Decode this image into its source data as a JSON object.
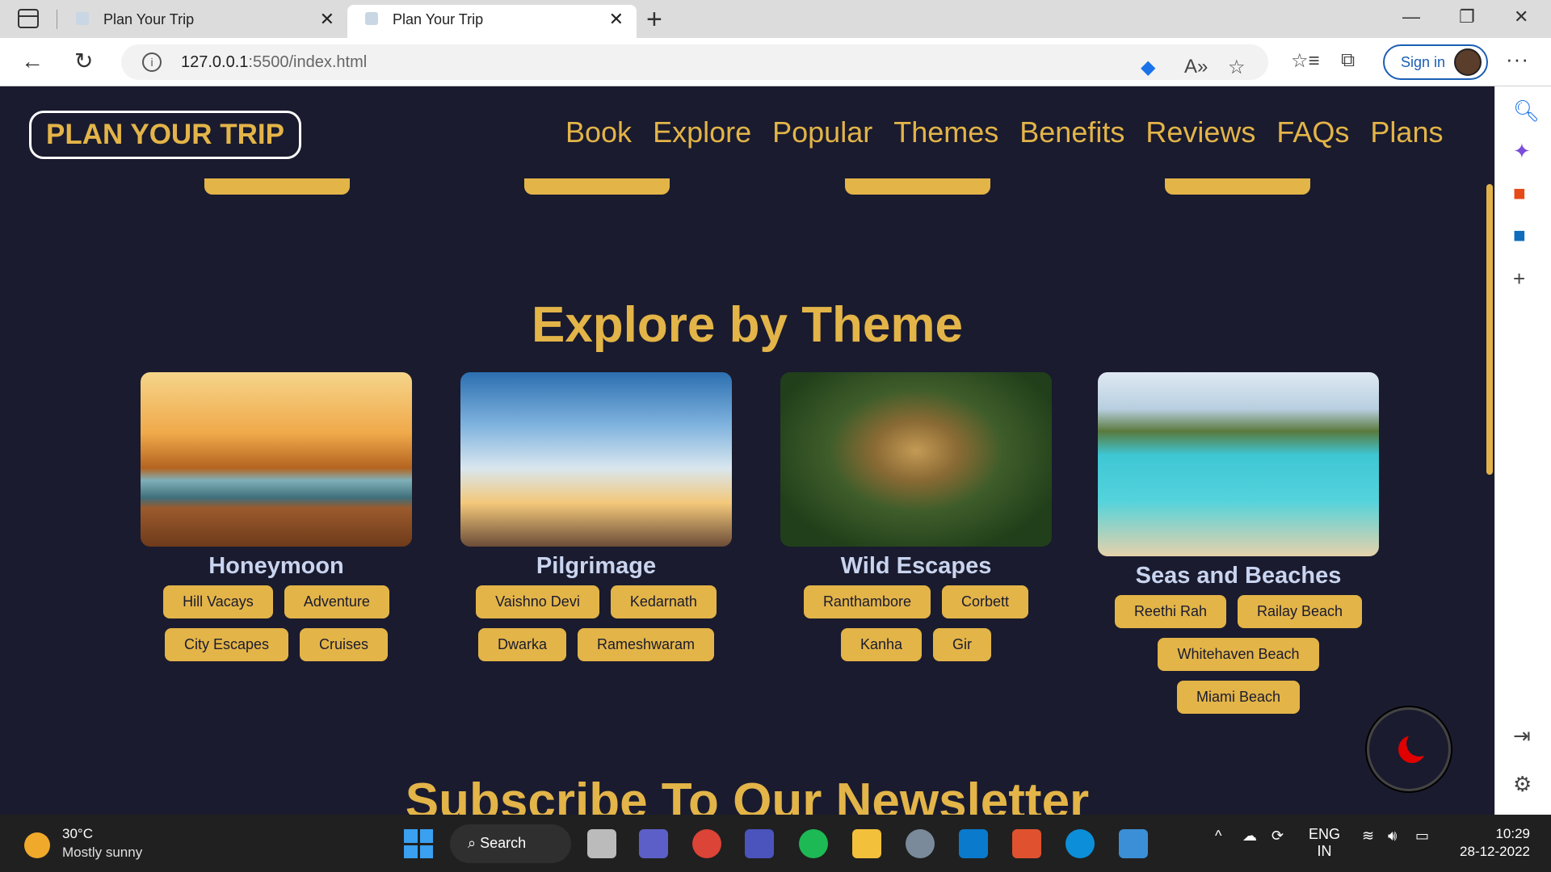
{
  "browser": {
    "tabs": [
      {
        "title": "Plan Your Trip"
      },
      {
        "title": "Plan Your Trip"
      }
    ],
    "url_host": "127.0.0.1",
    "url_rest": ":5500/index.html",
    "signin_label": "Sign in"
  },
  "site": {
    "logo": "PLAN YOUR TRIP",
    "nav": [
      "Book",
      "Explore",
      "Popular",
      "Themes",
      "Benefits",
      "Reviews",
      "FAQs",
      "Plans"
    ]
  },
  "explore": {
    "title": "Explore by Theme",
    "themes": [
      {
        "name": "Honeymoon",
        "tags": [
          "Hill Vacays",
          "Adventure",
          "City Escapes",
          "Cruises"
        ]
      },
      {
        "name": "Pilgrimage",
        "tags": [
          "Vaishno Devi",
          "Kedarnath",
          "Dwarka",
          "Rameshwaram"
        ]
      },
      {
        "name": "Wild Escapes",
        "tags": [
          "Ranthambore",
          "Corbett",
          "Kanha",
          "Gir"
        ]
      },
      {
        "name": "Seas and Beaches",
        "tags": [
          "Reethi Rah",
          "Railay Beach",
          "Whitehaven Beach",
          "Miami Beach"
        ]
      }
    ]
  },
  "newsletter": {
    "title": "Subscribe To Our Newsletter"
  },
  "taskbar": {
    "temp": "30°C",
    "weather": "Mostly sunny",
    "search_label": "Search",
    "lang": "ENG",
    "region": "IN",
    "time": "10:29",
    "date": "28-12-2022"
  },
  "colors": {
    "accent": "#e3b448",
    "background": "#1a1b2e",
    "theme_name": "#c9d4ef"
  }
}
